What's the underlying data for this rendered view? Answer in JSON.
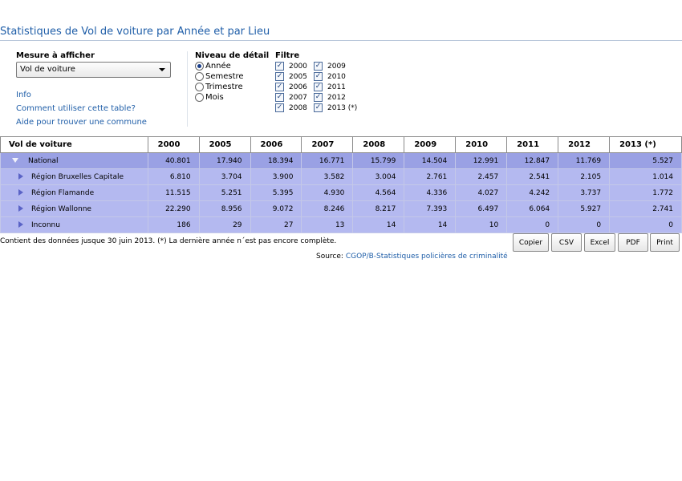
{
  "page_title": "Statistiques de Vol de voiture par Année et par Lieu",
  "measure": {
    "label": "Mesure à afficher",
    "selected": "Vol de voiture"
  },
  "links": [
    "Info",
    "Comment utiliser cette table?",
    "Aide pour trouver une commune"
  ],
  "detail": {
    "label": "Niveau de détail",
    "options": [
      {
        "label": "Année",
        "selected": true
      },
      {
        "label": "Semestre",
        "selected": false
      },
      {
        "label": "Trimestre",
        "selected": false
      },
      {
        "label": "Mois",
        "selected": false
      }
    ]
  },
  "filter": {
    "label": "Filtre",
    "col1": [
      "2000",
      "2005",
      "2006",
      "2007",
      "2008"
    ],
    "col2": [
      "2009",
      "2010",
      "2011",
      "2012",
      "2013 (*)"
    ],
    "check_glyph": "✓"
  },
  "table": {
    "header_label": "Vol de voiture",
    "columns": [
      "2000",
      "2005",
      "2006",
      "2007",
      "2008",
      "2009",
      "2010",
      "2011",
      "2012",
      "2013 (*)"
    ],
    "rows": [
      {
        "label": "National",
        "values": [
          "40.801",
          "17.940",
          "18.394",
          "16.771",
          "15.799",
          "14.504",
          "12.991",
          "12.847",
          "11.769",
          "5.527"
        ]
      },
      {
        "label": "Région Bruxelles Capitale",
        "values": [
          "6.810",
          "3.704",
          "3.900",
          "3.582",
          "3.004",
          "2.761",
          "2.457",
          "2.541",
          "2.105",
          "1.014"
        ]
      },
      {
        "label": "Région Flamande",
        "values": [
          "11.515",
          "5.251",
          "5.395",
          "4.930",
          "4.564",
          "4.336",
          "4.027",
          "4.242",
          "3.737",
          "1.772"
        ]
      },
      {
        "label": "Région Wallonne",
        "values": [
          "22.290",
          "8.956",
          "9.072",
          "8.246",
          "8.217",
          "7.393",
          "6.497",
          "6.064",
          "5.927",
          "2.741"
        ]
      },
      {
        "label": "Inconnu",
        "values": [
          "186",
          "29",
          "27",
          "13",
          "14",
          "14",
          "10",
          "0",
          "0",
          "0"
        ]
      }
    ]
  },
  "footnote": "Contient des données jusque 30 juin 2013.   (*) La dernière année n´est pas encore complète.",
  "source": {
    "prefix": "Source: ",
    "link": "CGOP/B-Statistiques policières de criminalité"
  },
  "buttons": {
    "copy": "Copier",
    "csv": "CSV",
    "excel": "Excel",
    "pdf": "PDF",
    "print": "Print"
  }
}
